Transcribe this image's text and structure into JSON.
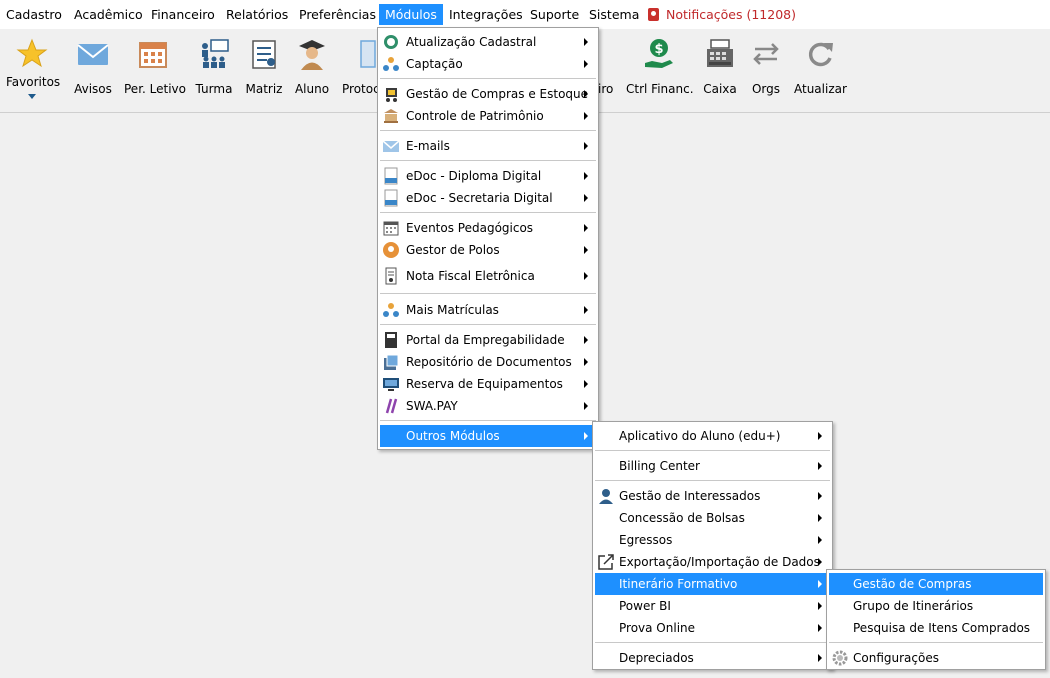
{
  "menubar": {
    "items": [
      "Cadastro",
      "Acadêmico",
      "Financeiro",
      "Relatórios",
      "Preferências",
      "Módulos",
      "Integrações",
      "Suporte",
      "Sistema"
    ],
    "notifications": "Notificações (11208)"
  },
  "toolbar": {
    "favoritos": "Favoritos",
    "avisos": "Avisos",
    "per_letivo": "Per. Letivo",
    "turma": "Turma",
    "matriz": "Matriz",
    "aluno": "Aluno",
    "protocolo": "Protoc",
    "financeiro_partial": "iro",
    "ctrl_financ": "Ctrl Financ.",
    "caixa": "Caixa",
    "orgs": "Orgs",
    "atualizar": "Atualizar"
  },
  "modulos_menu": {
    "items": [
      "Atualização Cadastral",
      "Captação",
      "Gestão de Compras e Estoque",
      "Controle de Patrimônio",
      "E-mails",
      "eDoc - Diploma Digital",
      "eDoc - Secretaria Digital",
      "Eventos Pedagógicos",
      "Gestor de Polos",
      "Nota Fiscal Eletrônica",
      "Mais Matrículas",
      "Portal da Empregabilidade",
      "Repositório de Documentos",
      "Reserva de Equipamentos",
      "SWA.PAY",
      "Outros Módulos"
    ]
  },
  "outros_menu": {
    "items": [
      "Aplicativo do Aluno (edu+)",
      "Billing Center",
      "Gestão de Interessados",
      "Concessão de Bolsas",
      "Egressos",
      "Exportação/Importação de Dados",
      "Itinerário Formativo",
      "Power BI",
      "Prova Online",
      "Depreciados"
    ]
  },
  "itinerario_menu": {
    "items": [
      "Gestão de Compras",
      "Grupo de Itinerários",
      "Pesquisa de Itens Comprados",
      "Configurações"
    ]
  },
  "colors": {
    "highlight": "#1e90ff",
    "notification": "#c0292b"
  }
}
